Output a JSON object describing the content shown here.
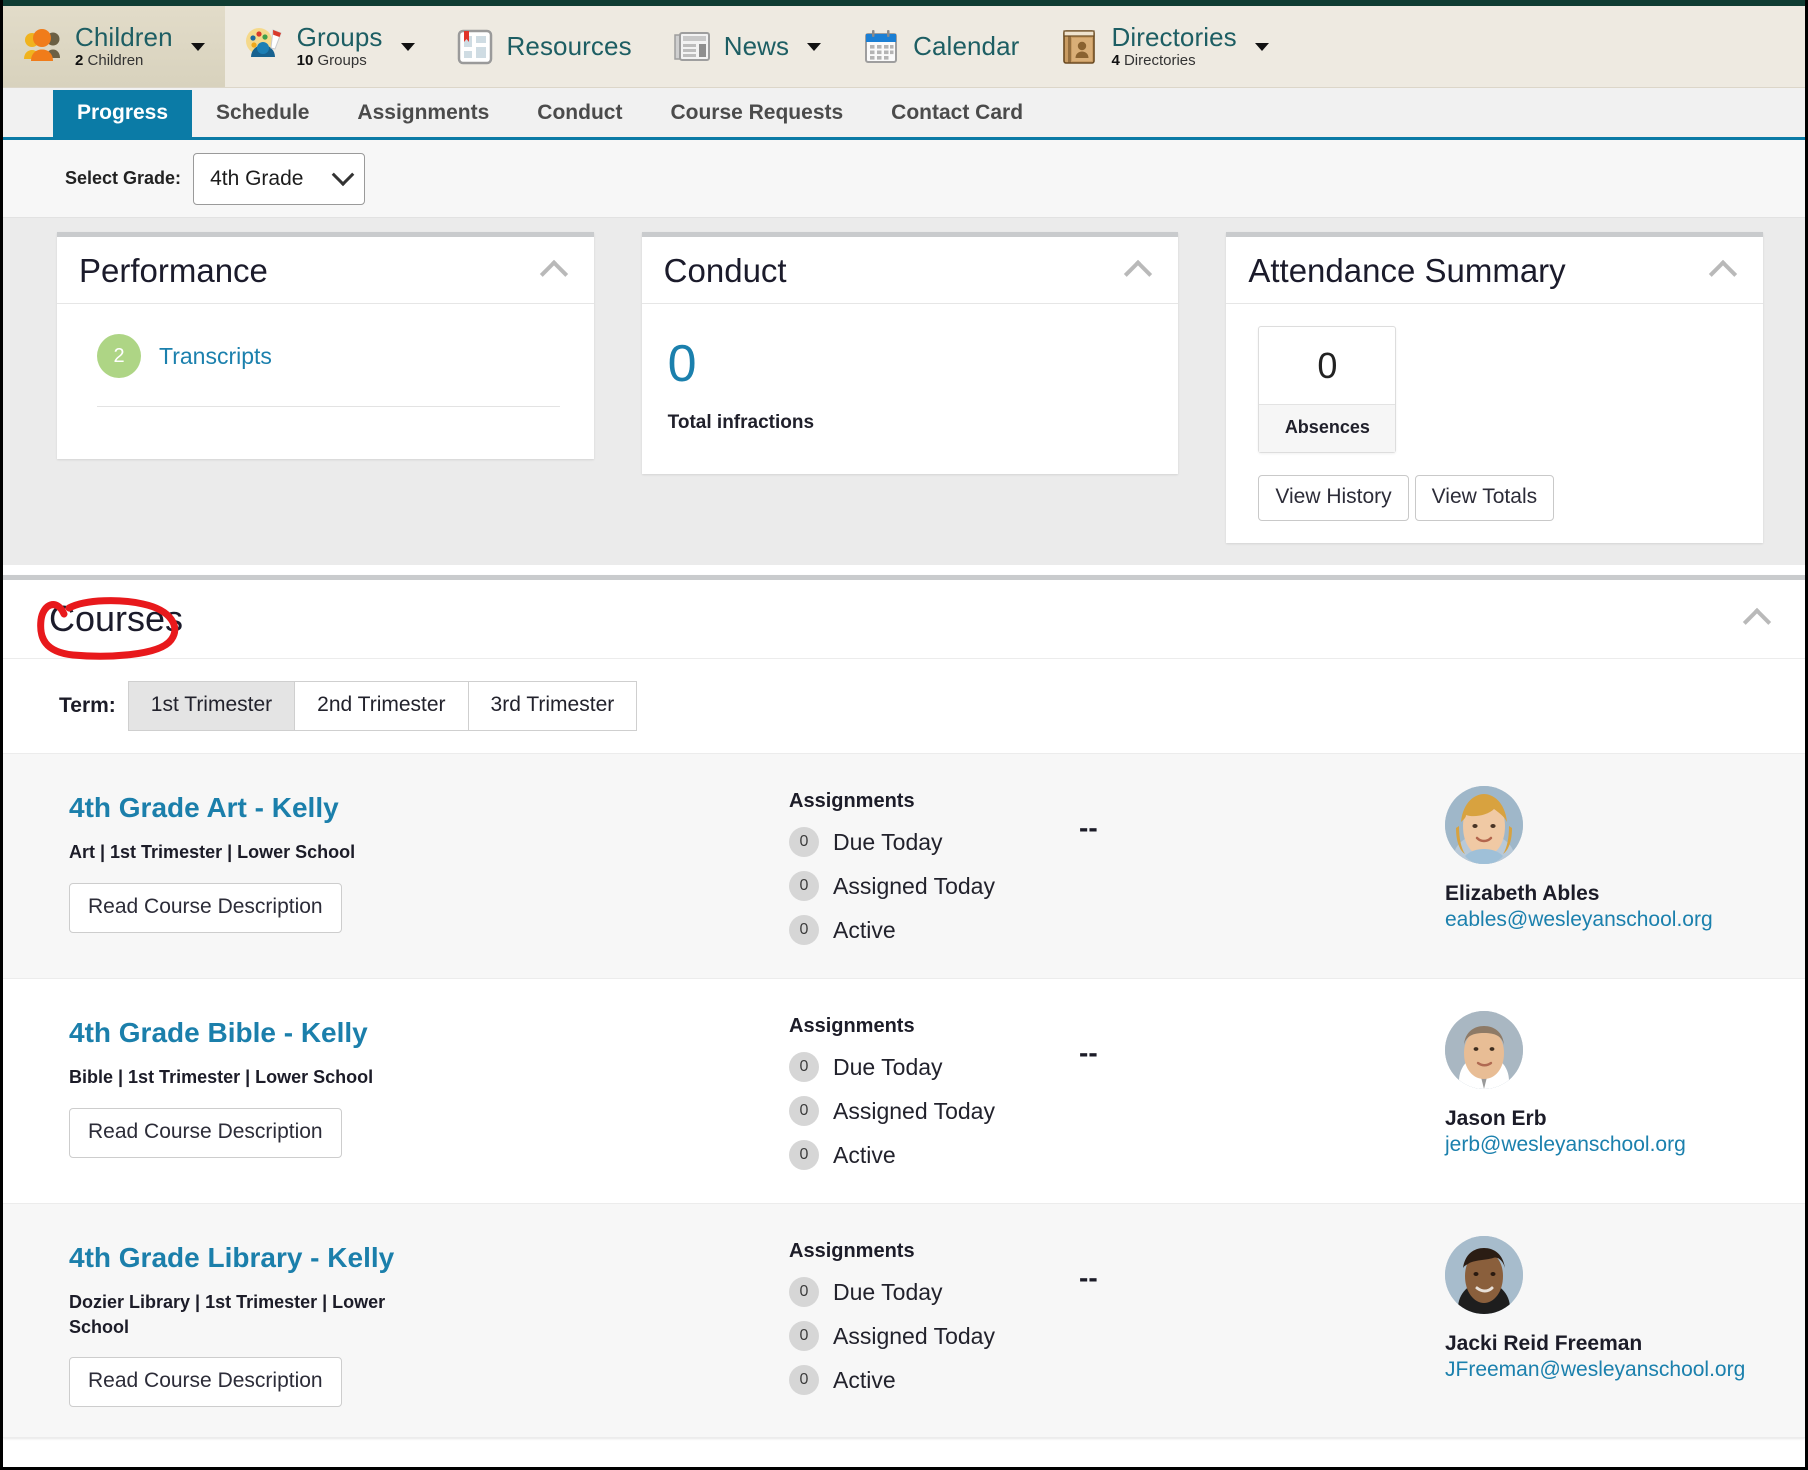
{
  "module_nav": [
    {
      "title": "Children",
      "sub_count": "2",
      "sub_label": "Children",
      "icon": "children-group-icon",
      "caret": true,
      "active": true
    },
    {
      "title": "Groups",
      "sub_count": "10",
      "sub_label": "Groups",
      "icon": "groups-palette-icon",
      "caret": true,
      "active": false
    },
    {
      "title": "Resources",
      "sub_count": "",
      "sub_label": "",
      "icon": "resources-page-icon",
      "caret": false,
      "active": false
    },
    {
      "title": "News",
      "sub_count": "",
      "sub_label": "",
      "icon": "news-paper-icon",
      "caret": true,
      "active": false
    },
    {
      "title": "Calendar",
      "sub_count": "",
      "sub_label": "",
      "icon": "calendar-icon",
      "caret": false,
      "active": false
    },
    {
      "title": "Directories",
      "sub_count": "4",
      "sub_label": "Directories",
      "icon": "directory-book-icon",
      "caret": true,
      "active": false
    }
  ],
  "tabs": [
    {
      "label": "Progress",
      "active": true
    },
    {
      "label": "Schedule",
      "active": false
    },
    {
      "label": "Assignments",
      "active": false
    },
    {
      "label": "Conduct",
      "active": false
    },
    {
      "label": "Course Requests",
      "active": false
    },
    {
      "label": "Contact Card",
      "active": false
    }
  ],
  "grade_select": {
    "label": "Select Grade:",
    "value": "4th Grade"
  },
  "cards": {
    "performance": {
      "title": "Performance",
      "collapse_icon": "chevron-up-icon",
      "transcripts_count": "2",
      "transcripts_label": "Transcripts"
    },
    "conduct": {
      "title": "Conduct",
      "collapse_icon": "chevron-up-icon",
      "total_value": "0",
      "total_label": "Total infractions"
    },
    "attendance": {
      "title": "Attendance Summary",
      "collapse_icon": "chevron-up-icon",
      "absences_value": "0",
      "absences_label": "Absences",
      "view_history_label": "View History",
      "view_totals_label": "View Totals"
    }
  },
  "courses": {
    "title": "Courses",
    "collapse_icon": "chevron-up-icon",
    "annotation": {
      "shape": "hand-drawn-ellipse",
      "color": "#e8191c",
      "target": "Courses"
    },
    "term_label": "Term:",
    "terms": [
      {
        "label": "1st Trimester",
        "active": true
      },
      {
        "label": "2nd Trimester",
        "active": false
      },
      {
        "label": "3rd Trimester",
        "active": false
      }
    ],
    "assignments_heading": "Assignments",
    "assignment_rows": [
      {
        "count": "0",
        "label": "Due Today"
      },
      {
        "count": "0",
        "label": "Assigned Today"
      },
      {
        "count": "0",
        "label": "Active"
      }
    ],
    "read_description_label": "Read Course Description",
    "items": [
      {
        "name": "4th Grade Art - Kelly",
        "meta": "Art | 1st Trimester | Lower School",
        "grade": "--",
        "assignments": [
          {
            "count": "0",
            "label": "Due Today"
          },
          {
            "count": "0",
            "label": "Assigned Today"
          },
          {
            "count": "0",
            "label": "Active"
          }
        ],
        "teacher_name": "Elizabeth Ables",
        "teacher_email": "eables@wesleyanschool.org",
        "avatar": "teacher-photo-elizabeth-ables"
      },
      {
        "name": "4th Grade Bible - Kelly",
        "meta": "Bible | 1st Trimester | Lower School",
        "grade": "--",
        "assignments": [
          {
            "count": "0",
            "label": "Due Today"
          },
          {
            "count": "0",
            "label": "Assigned Today"
          },
          {
            "count": "0",
            "label": "Active"
          }
        ],
        "teacher_name": "Jason Erb",
        "teacher_email": "jerb@wesleyanschool.org",
        "avatar": "teacher-photo-jason-erb"
      },
      {
        "name": "4th Grade Library - Kelly",
        "meta": "Dozier Library | 1st Trimester | Lower School",
        "grade": "--",
        "assignments": [
          {
            "count": "0",
            "label": "Due Today"
          },
          {
            "count": "0",
            "label": "Assigned Today"
          },
          {
            "count": "0",
            "label": "Active"
          }
        ],
        "teacher_name": "Jacki Reid Freeman",
        "teacher_email": "JFreeman@wesleyanschool.org",
        "avatar": "teacher-photo-jacki-reid-freeman"
      }
    ]
  },
  "colors": {
    "accent_blue": "#0b7ba6",
    "link_blue": "#1b80ad",
    "nav_bg": "#eeeae1",
    "top_strip": "#0f3d33",
    "annotation_red": "#e8191c",
    "badge_green": "#aed585"
  }
}
